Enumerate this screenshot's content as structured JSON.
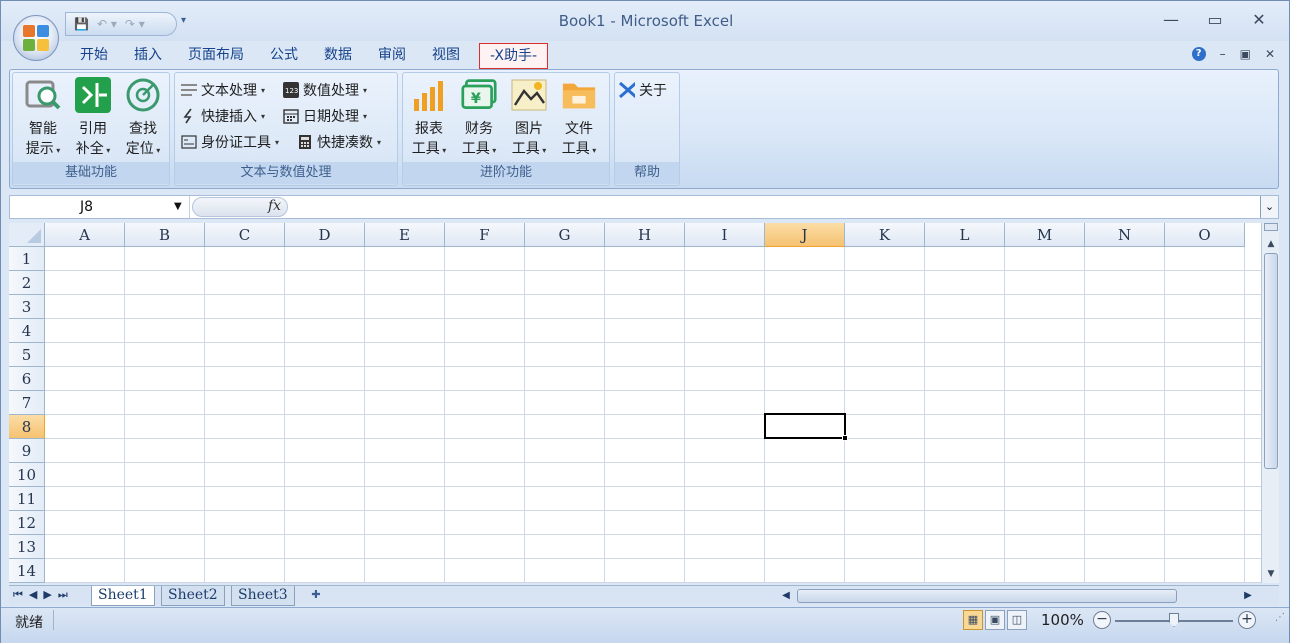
{
  "window": {
    "title": "Book1 - Microsoft Excel",
    "controls": {
      "minimize": "—",
      "maximize": "▭",
      "close": "✕"
    }
  },
  "quick_access": {
    "save_icon": "save-icon",
    "undo_icon": "undo-icon",
    "redo_icon": "redo-icon"
  },
  "tabs": [
    {
      "label": "开始"
    },
    {
      "label": "插入"
    },
    {
      "label": "页面布局"
    },
    {
      "label": "公式"
    },
    {
      "label": "数据"
    },
    {
      "label": "审阅"
    },
    {
      "label": "视图"
    },
    {
      "label": "-X助手-",
      "active": true
    }
  ],
  "doc_controls": {
    "help": "?",
    "minimize": "–",
    "restore": "▣",
    "close": "✕"
  },
  "ribbon": {
    "groups": {
      "basic": {
        "label": "基础功能",
        "buttons": [
          {
            "line1": "智能",
            "line2": "提示"
          },
          {
            "line1": "引用",
            "line2": "补全"
          },
          {
            "line1": "查找",
            "line2": "定位"
          }
        ]
      },
      "text_num": {
        "label": "文本与数值处理",
        "buttons": [
          {
            "label": "文本处理"
          },
          {
            "label": "数值处理"
          },
          {
            "label": "快捷插入"
          },
          {
            "label": "日期处理"
          },
          {
            "label": "身份证工具"
          },
          {
            "label": "快捷凑数"
          }
        ]
      },
      "advanced": {
        "label": "进阶功能",
        "buttons": [
          {
            "line1": "报表",
            "line2": "工具"
          },
          {
            "line1": "财务",
            "line2": "工具"
          },
          {
            "line1": "图片",
            "line2": "工具"
          },
          {
            "line1": "文件",
            "line2": "工具"
          }
        ]
      },
      "help": {
        "label": "帮助",
        "buttons": [
          {
            "label": "关于"
          }
        ]
      }
    }
  },
  "formula_bar": {
    "name_box": "J8",
    "fx": "fx",
    "value": ""
  },
  "grid": {
    "columns": [
      "A",
      "B",
      "C",
      "D",
      "E",
      "F",
      "G",
      "H",
      "I",
      "J",
      "K",
      "L",
      "M",
      "N",
      "O"
    ],
    "rows": [
      "1",
      "2",
      "3",
      "4",
      "5",
      "6",
      "7",
      "8",
      "9",
      "10",
      "11",
      "12",
      "13",
      "14"
    ],
    "selected_column": "J",
    "selected_row": "8",
    "active_cell": "J8"
  },
  "sheets": [
    {
      "label": "Sheet1",
      "active": true
    },
    {
      "label": "Sheet2"
    },
    {
      "label": "Sheet3"
    }
  ],
  "status": {
    "mode": "就绪",
    "zoom": "100%"
  },
  "colors": {
    "selection_header": "#f5c271",
    "tab_highlight_border": "#d9302c",
    "ribbon": "#dce8f7"
  }
}
